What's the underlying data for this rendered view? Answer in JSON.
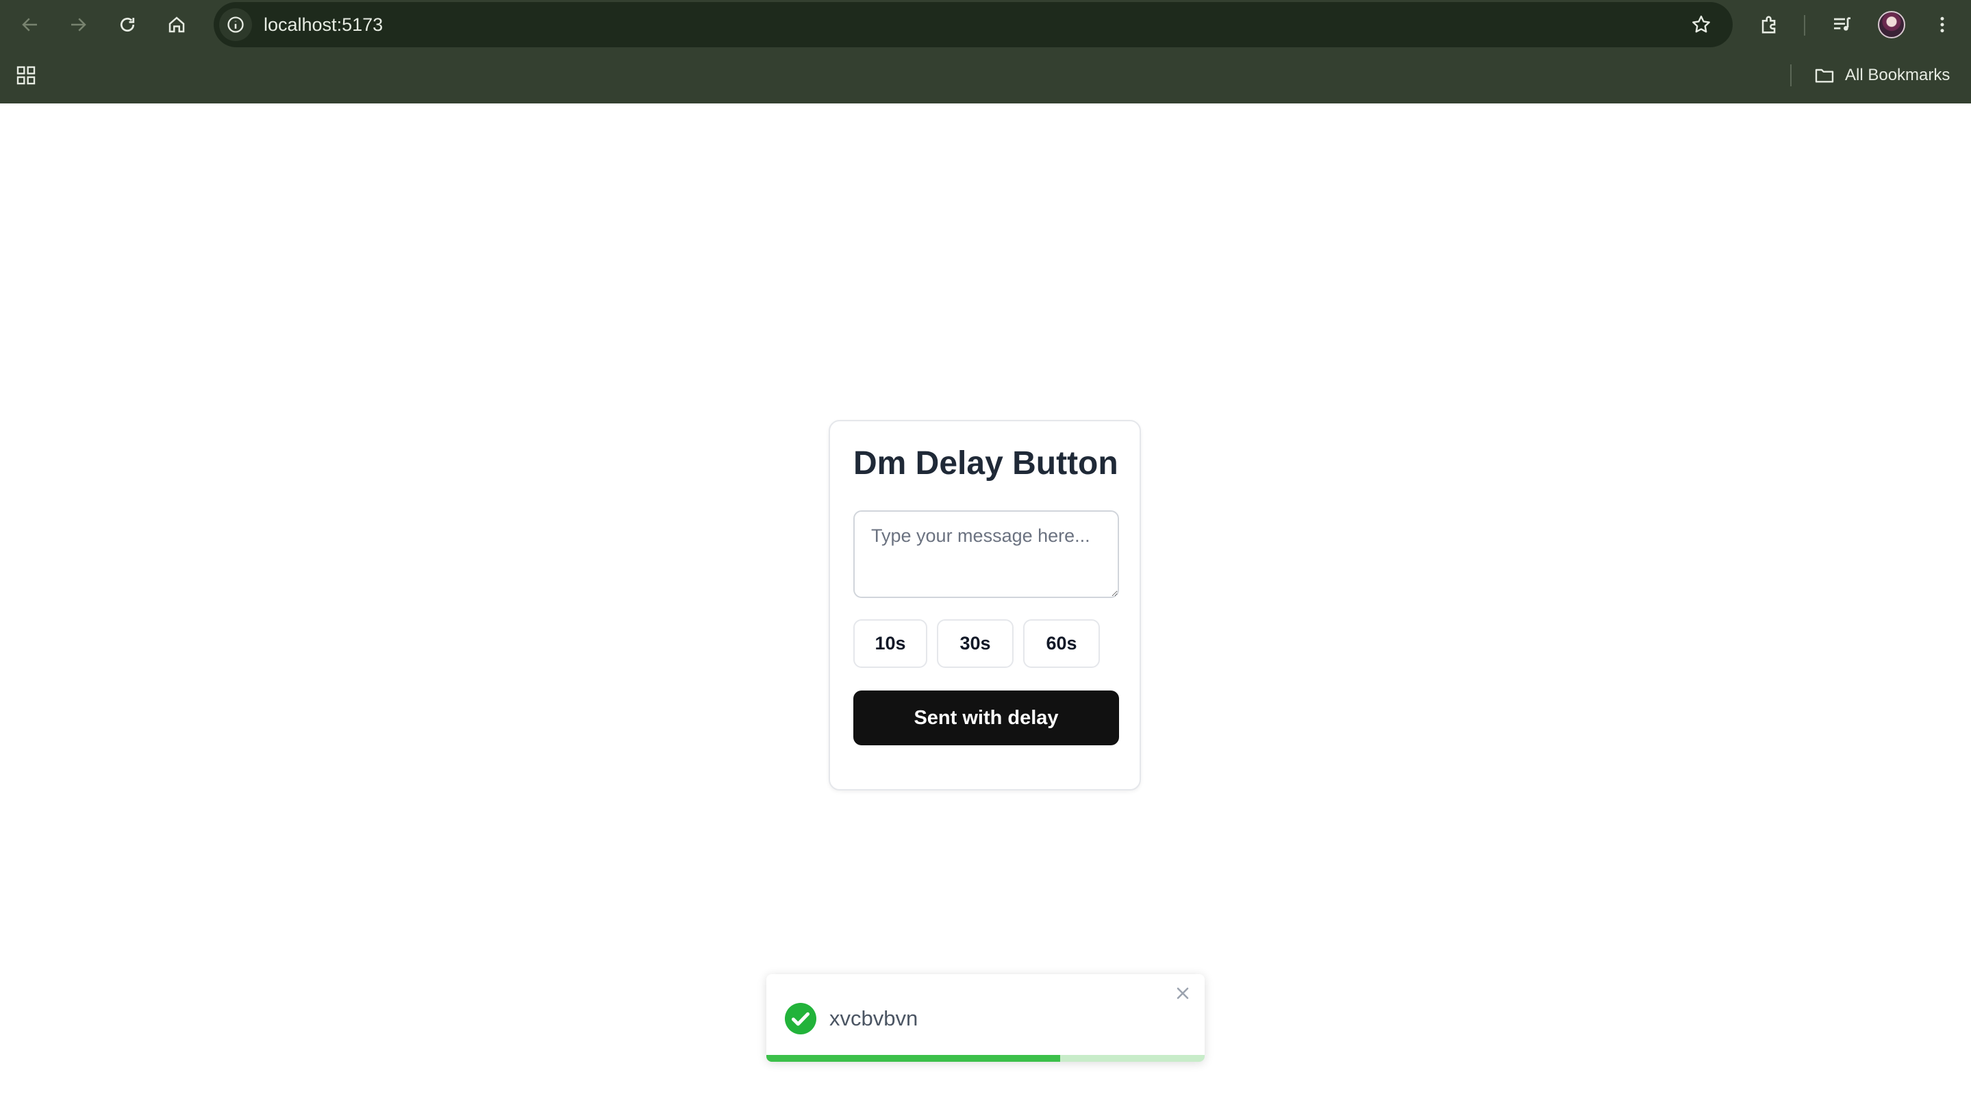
{
  "browser": {
    "url": "localhost:5173",
    "bookmarks_label": "All Bookmarks",
    "toolbar_icons": [
      "back-icon",
      "forward-icon",
      "reload-icon",
      "home-icon",
      "site-info-icon",
      "star-icon",
      "extensions-icon",
      "media-icon",
      "profile-avatar",
      "more-icon"
    ],
    "chrome_color": "#344030"
  },
  "card": {
    "title": "Dm Delay Button",
    "message_placeholder": "Type your message here...",
    "delay_options": [
      "10s",
      "30s",
      "60s"
    ],
    "send_label": "Sent with delay"
  },
  "toast": {
    "message": "xvcbvbvn",
    "status": "success",
    "status_color": "#22b33a",
    "progress": 0.67
  }
}
